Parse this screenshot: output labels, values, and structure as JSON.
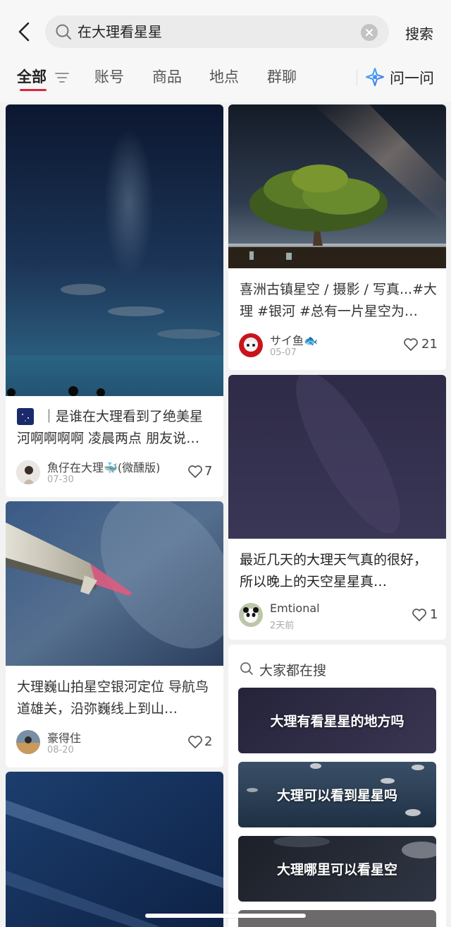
{
  "search": {
    "query": "在大理看星星",
    "button_label": "搜索"
  },
  "tabs": [
    {
      "label": "全部"
    },
    {
      "label": "账号"
    },
    {
      "label": "商品"
    },
    {
      "label": "地点"
    },
    {
      "label": "群聊"
    }
  ],
  "ask": {
    "label": "问一问"
  },
  "notes": [
    {
      "title": "｜是谁在大理看到了绝美星河啊啊啊啊 凌晨两点 朋友说…",
      "author": "魚仔在大理🐳(微醺版)",
      "date": "07-30",
      "likes": "7"
    },
    {
      "title": "喜洲古镇星空 / 摄影 / 写真...#大理 #银河 #总有一片星空为…",
      "author": "サイ鱼🐟",
      "date": "05-07",
      "likes": "21"
    },
    {
      "title": "大理巍山拍星空银河定位 导航鸟道雄关，沿弥巍线上到山…",
      "author": "豪得住",
      "date": "08-20",
      "likes": "2"
    },
    {
      "title": "最近几天的大理天气真的很好，所以晚上的天空星星真…",
      "author": "Emtional",
      "date": "2天前",
      "likes": "1"
    }
  ],
  "trending": {
    "header": "大家都在搜",
    "items": [
      {
        "label": "大理有看星星的地方吗"
      },
      {
        "label": "大理可以看到星星吗"
      },
      {
        "label": "大理哪里可以看星空"
      }
    ]
  },
  "colors": {
    "accent": "#e0243a",
    "background": "#f2f2f2"
  }
}
